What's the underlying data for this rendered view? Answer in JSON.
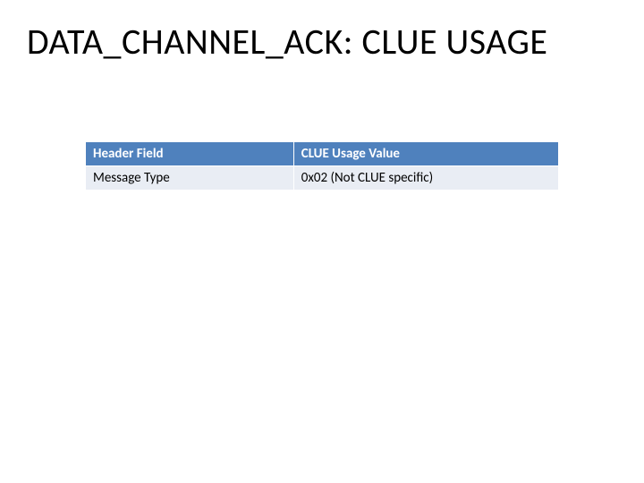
{
  "title": "DATA_CHANNEL_ACK: CLUE USAGE",
  "table": {
    "headers": [
      "Header Field",
      "CLUE Usage Value"
    ],
    "rows": [
      {
        "field": "Message Type",
        "value": "0x02 (Not CLUE specific)"
      }
    ]
  },
  "chart_data": {
    "type": "table",
    "title": "DATA_CHANNEL_ACK: CLUE USAGE",
    "columns": [
      "Header Field",
      "CLUE Usage Value"
    ],
    "rows": [
      [
        "Message Type",
        "0x02 (Not CLUE specific)"
      ]
    ]
  }
}
